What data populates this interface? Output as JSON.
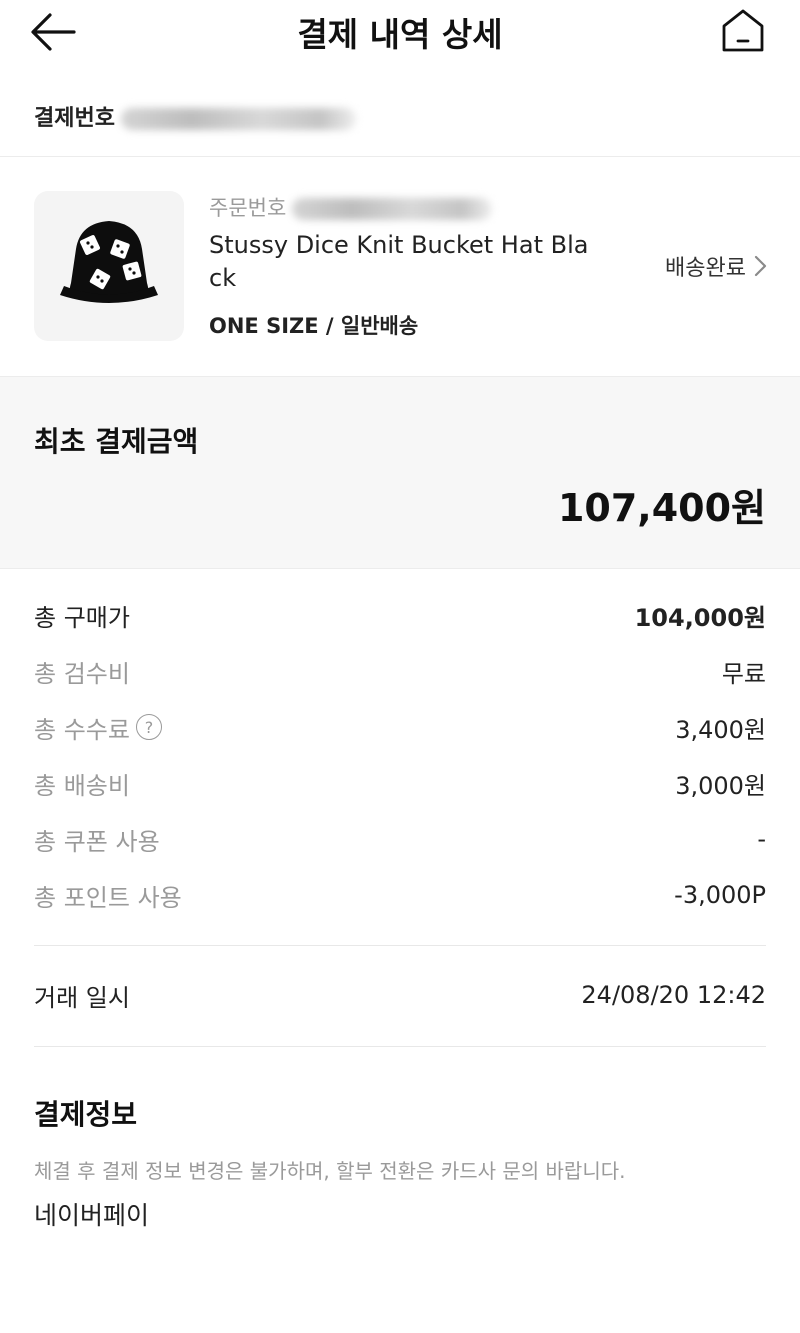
{
  "header": {
    "title": "결제 내역 상세",
    "back_icon": "arrow-left-icon",
    "home_icon": "home-icon"
  },
  "payment_number_label": "결제번호",
  "order": {
    "order_number_label": "주문번호",
    "product_name": "Stussy Dice Knit Bucket Hat Black",
    "option": "ONE SIZE / 일반배송",
    "status": "배송완료",
    "status_icon": "chevron-right-icon"
  },
  "summary": {
    "label": "최초 결제금액",
    "amount": "107,400원"
  },
  "breakdown": [
    {
      "label": "총 구매가",
      "value": "104,000원"
    },
    {
      "label": "총 검수비",
      "value": "무료"
    },
    {
      "label": "총 수수료",
      "value": "3,400원",
      "help": "?"
    },
    {
      "label": "총 배송비",
      "value": "3,000원"
    },
    {
      "label": "총 쿠폰 사용",
      "value": "-"
    },
    {
      "label": "총 포인트 사용",
      "value": "-3,000P"
    }
  ],
  "transaction": {
    "label": "거래 일시",
    "value": "24/08/20 12:42"
  },
  "payment_info": {
    "heading": "결제정보",
    "note": "체결 후 결제 정보 변경은 불가하며, 할부 전환은 카드사 문의 바랍니다.",
    "method": "네이버페이"
  },
  "colors": {
    "text": "#222222",
    "muted": "#9a9a9a",
    "summary_bg": "#f7f7f7",
    "divider": "#ececec"
  }
}
